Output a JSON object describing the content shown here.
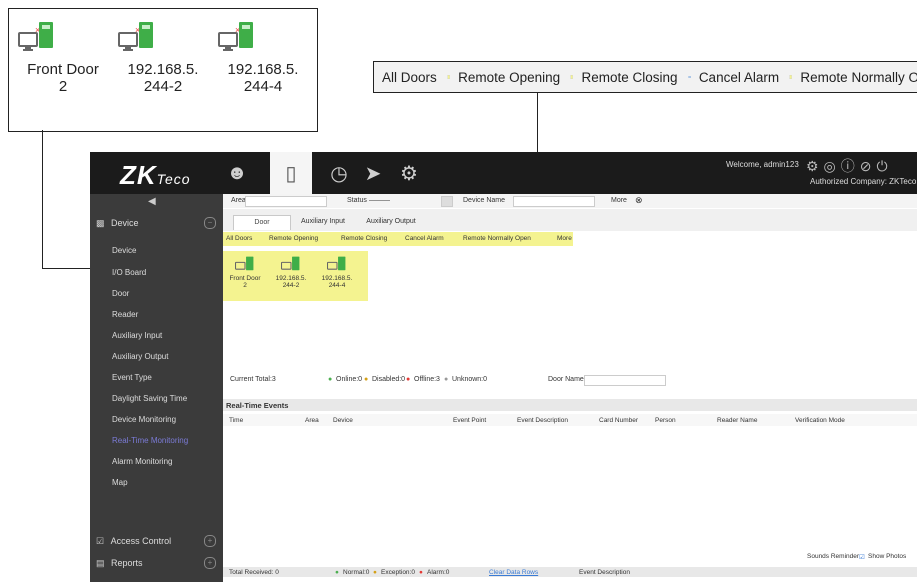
{
  "callout_doors": {
    "doors": [
      {
        "name": "Front Door\n2",
        "line1": "Front Door",
        "line2": "2"
      },
      {
        "name": "192.168.5.244-2",
        "line1": "192.168.5.",
        "line2": "244-2"
      },
      {
        "name": "192.168.5.244-4",
        "line1": "192.168.5.",
        "line2": "244-4"
      }
    ]
  },
  "callout_toolbar": {
    "items": [
      "All Doors",
      "Remote Opening",
      "Remote Closing",
      "Cancel Alarm",
      "Remote Normally Ope"
    ]
  },
  "app": {
    "logo": "ZKTeco",
    "logo_main": "ZK",
    "logo_tail": "Teco",
    "welcome": "Welcome, admin123",
    "company": "Authorized Company: ZKTeco"
  },
  "sidebar": {
    "group_device": "Device",
    "items": [
      "Device",
      "I/O Board",
      "Door",
      "Reader",
      "Auxiliary Input",
      "Auxiliary Output",
      "Event Type",
      "Daylight Saving Time",
      "Device Monitoring",
      "Real-Time Monitoring",
      "Alarm Monitoring",
      "Map"
    ],
    "group_access": "Access Control",
    "group_reports": "Reports"
  },
  "filter": {
    "area_label": "Area",
    "status_label": "Status",
    "status_value": "———",
    "device_name_label": "Device Name",
    "more_label": "More"
  },
  "tabs": [
    "Door",
    "Auxiliary Input",
    "Auxiliary Output"
  ],
  "opbar": {
    "items": [
      "All Doors",
      "Remote Opening",
      "Remote Closing",
      "Cancel Alarm",
      "Remote Normally Open",
      "More"
    ]
  },
  "door_panel": {
    "doors": [
      {
        "line1": "Front Door",
        "line2": "2"
      },
      {
        "line1": "192.168.5.",
        "line2": "244-2"
      },
      {
        "line1": "192.168.5.",
        "line2": "244-4"
      }
    ]
  },
  "summary": {
    "current_total": "Current Total:3",
    "online": "Online:0",
    "disabled": "Disabled:0",
    "offline": "Offline:3",
    "unknown": "Unknown:0",
    "door_name_label": "Door Name"
  },
  "realtime": {
    "title": "Real-Time Events",
    "columns": [
      "Time",
      "Area",
      "Device",
      "Event Point",
      "Event Description",
      "Card Number",
      "Person",
      "Reader Name",
      "Verification Mode"
    ]
  },
  "bottom": {
    "sounds_reminder": "Sounds Reminder",
    "show_photos": "Show Photos",
    "total_received": "Total Received: 0",
    "normal": "Normal:0",
    "exception": "Exception:0",
    "alarm": "Alarm:0",
    "clear_rows": "Clear Data Rows",
    "event_description": "Event Description"
  },
  "colors": {
    "highlight": "#f4f390",
    "online": "#4caf50",
    "offline": "#e53935",
    "disabled": "#d4a017",
    "door_green": "#3fae48"
  }
}
